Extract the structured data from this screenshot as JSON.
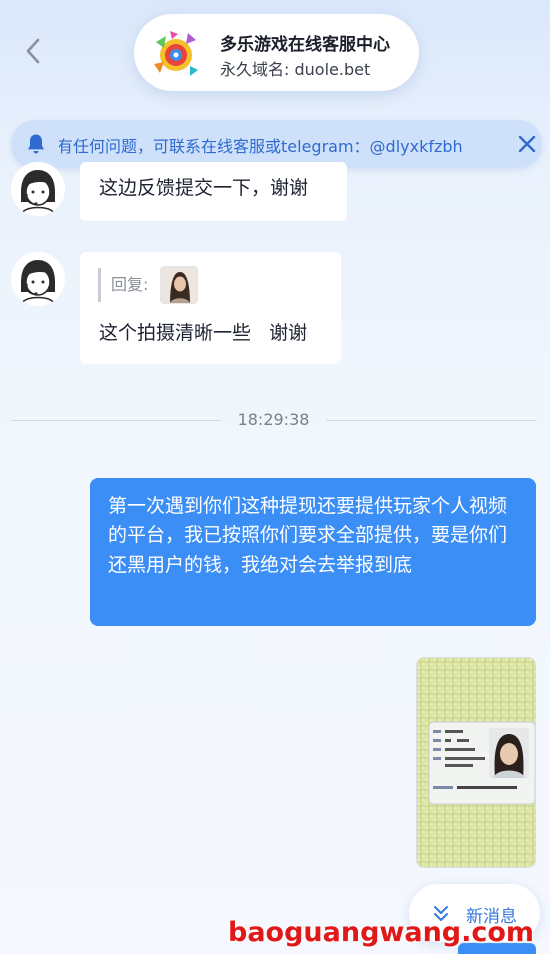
{
  "header": {
    "title": "多乐游戏在线客服中心",
    "domain": "永久域名: duole.bet"
  },
  "notice": {
    "text": "若有任何问题，可联系在线客服或telegram：@dlyxkfzbh"
  },
  "messages": {
    "m1": {
      "text": "这边反馈提交一下，谢谢"
    },
    "m2": {
      "reply_label": "回复:",
      "text": "这个拍摄清晰一些   谢谢"
    },
    "time": "18:29:38",
    "m3": {
      "text": "第一次遇到你们这种提现还要提供玩家个人视频的平台，我已按照你们要求全部提供，要是你们还黑用户的钱，我绝对会去举报到底"
    }
  },
  "new_message_button": {
    "label": "新消息"
  },
  "watermark": "baoguangwang.com",
  "colors": {
    "accent": "#3a8ef6",
    "notice_bg": "#cfe1fa",
    "notice_text": "#2f6ad0",
    "watermark": "#e01818"
  },
  "icons": {
    "back": "chevron-left-icon",
    "bell": "bell-icon",
    "close": "close-icon",
    "new_messages": "double-chevron-down-icon"
  }
}
